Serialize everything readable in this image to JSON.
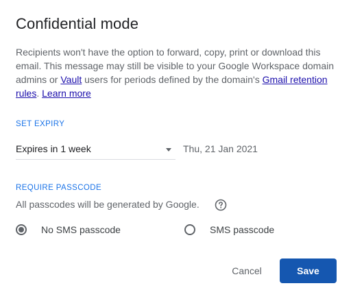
{
  "dialog": {
    "title": "Confidential mode",
    "description": {
      "part1": "Recipients won't have the option to forward, copy, print or download this email. This message may still be visible to your Google Workspace domain admins or ",
      "vault_link": "Vault",
      "part2": " users for periods defined by the domain's ",
      "retention_link": "Gmail retention rules",
      "part3": ". ",
      "learn_more_link": "Learn more"
    },
    "expiry": {
      "section_label": "SET EXPIRY",
      "selected": "Expires in 1 week",
      "date": "Thu, 21 Jan 2021"
    },
    "passcode": {
      "section_label": "REQUIRE PASSCODE",
      "note": "All passcodes will be generated by Google.",
      "options": [
        {
          "label": "No SMS passcode",
          "selected": true
        },
        {
          "label": "SMS passcode",
          "selected": false
        }
      ]
    },
    "actions": {
      "cancel_label": "Cancel",
      "save_label": "Save"
    }
  },
  "icons": {
    "help": "help-circle-icon",
    "dropdown": "dropdown-arrow-icon"
  },
  "colors": {
    "accent": "#1a73e8",
    "save_button": "#1557b0",
    "link": "#1a0dab"
  }
}
